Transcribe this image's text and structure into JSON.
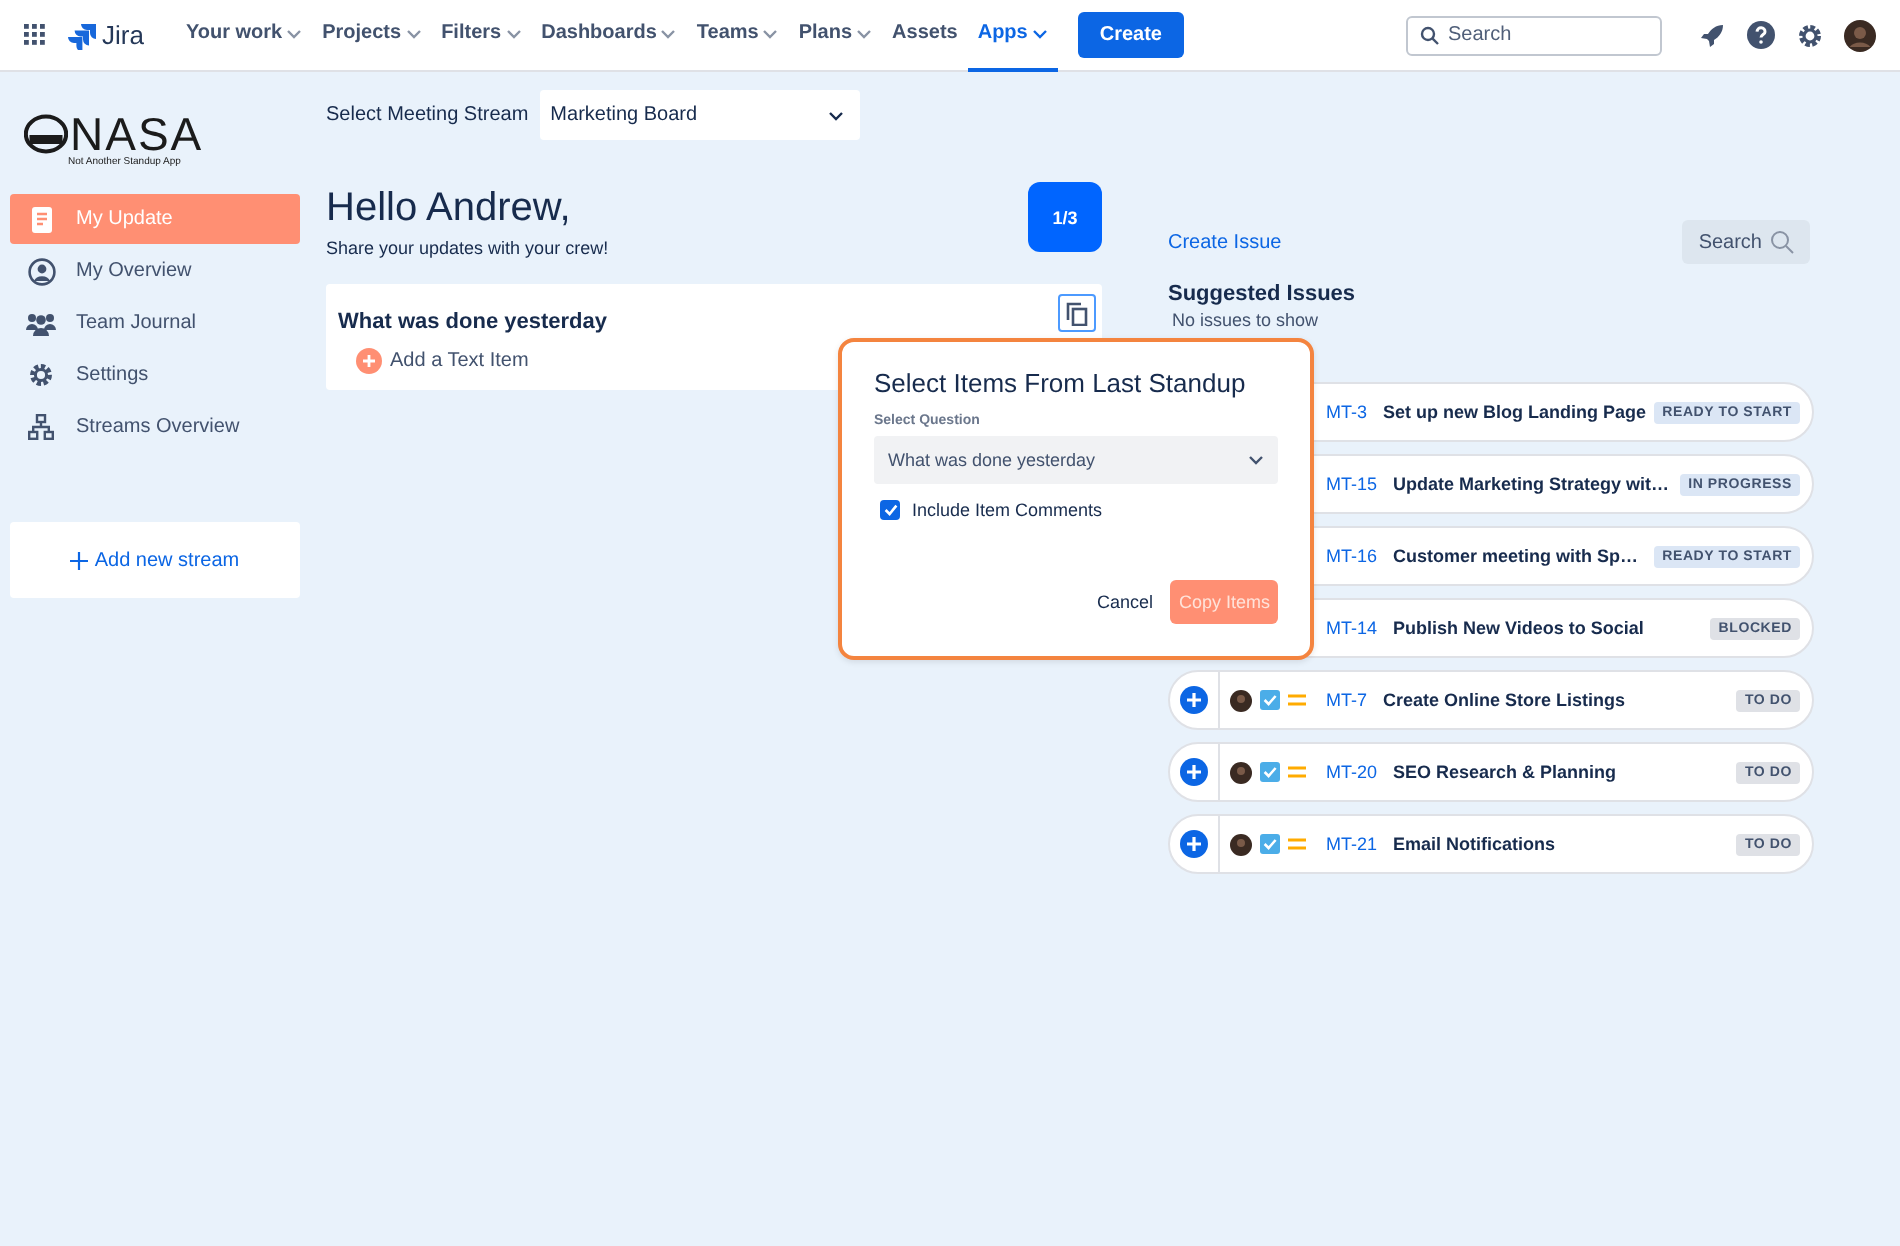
{
  "topbar": {
    "product": "Jira",
    "nav": [
      {
        "label": "Your work",
        "dropdown": true,
        "selected": false
      },
      {
        "label": "Projects",
        "dropdown": true,
        "selected": false
      },
      {
        "label": "Filters",
        "dropdown": true,
        "selected": false
      },
      {
        "label": "Dashboards",
        "dropdown": true,
        "selected": false
      },
      {
        "label": "Teams",
        "dropdown": true,
        "selected": false
      },
      {
        "label": "Plans",
        "dropdown": true,
        "selected": false
      },
      {
        "label": "Assets",
        "dropdown": false,
        "selected": false
      },
      {
        "label": "Apps",
        "dropdown": true,
        "selected": true
      }
    ],
    "create_button": "Create",
    "search": {
      "placeholder": "Search"
    }
  },
  "sidebar": {
    "logo": {
      "title": "NASA",
      "tagline": "Not Another Standup App"
    },
    "items": [
      {
        "label": "My Update",
        "selected": true
      },
      {
        "label": "My Overview",
        "selected": false
      },
      {
        "label": "Team Journal",
        "selected": false
      },
      {
        "label": "Settings",
        "selected": false
      },
      {
        "label": "Streams Overview",
        "selected": false
      }
    ],
    "add_stream": "Add new stream"
  },
  "main": {
    "stream_label": "Select Meeting Stream",
    "stream_value": "Marketing Board",
    "greeting": "Hello Andrew,",
    "subtitle": "Share your updates with your crew!",
    "counter": "1/3",
    "question_card": {
      "title": "What was done yesterday",
      "add_item": "Add a Text Item"
    }
  },
  "dialog": {
    "title": "Select Items From Last Standup",
    "question_label": "Select Question",
    "question_value": "What was done yesterday",
    "include_comments": {
      "label": "Include Item Comments",
      "checked": true
    },
    "cancel": "Cancel",
    "confirm": {
      "label": "Copy Items",
      "disabled": true
    }
  },
  "issues_panel": {
    "create_issue": "Create Issue",
    "search_button": "Search",
    "suggested_title": "Suggested Issues",
    "suggested_empty": "No issues to show",
    "issues": [
      {
        "kind": "overlapped",
        "key": "MT-3",
        "title": "Set up new Blog Landing Page",
        "status": "READY TO START"
      },
      {
        "kind": "overlapped",
        "key": "MT-15",
        "title": "Update Marketing Strategy wit…",
        "status": "IN PROGRESS"
      },
      {
        "kind": "overlapped",
        "key": "MT-16",
        "title": "Customer meeting with Sp…",
        "status": "READY TO START"
      },
      {
        "kind": "overlapped",
        "key": "MT-14",
        "title": "Publish New Videos to Social",
        "status": "BLOCKED"
      },
      {
        "kind": "full",
        "key": "MT-7",
        "title": "Create Online Store Listings",
        "status": "TO DO"
      },
      {
        "kind": "full",
        "key": "MT-20",
        "title": "SEO Research & Planning",
        "status": "TO DO"
      },
      {
        "kind": "full",
        "key": "MT-21",
        "title": "Email Notifications",
        "status": "TO DO"
      }
    ]
  }
}
